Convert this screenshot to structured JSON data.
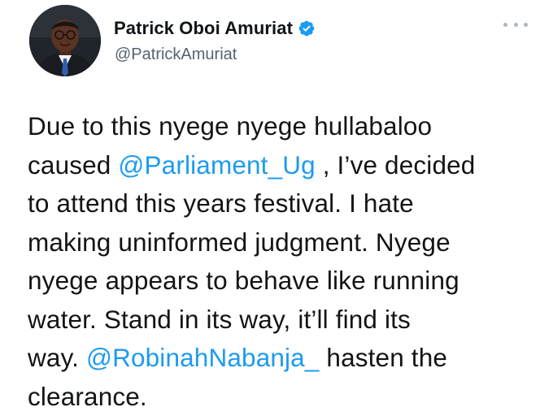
{
  "author": {
    "display_name": "Patrick Oboi Amuriat",
    "handle": "@PatrickAmuriat",
    "verified": true,
    "avatar_icon": "profile-photo"
  },
  "menu": {
    "icon": "more-options-icon"
  },
  "tweet": {
    "lines": [
      {
        "segments": [
          {
            "text": "Due to this nyege nyege hullabaloo"
          }
        ]
      },
      {
        "segments": [
          {
            "text": "caused "
          },
          {
            "text": "@Parliament_Ug",
            "mention": true
          },
          {
            "text": " , I’ve decided"
          }
        ]
      },
      {
        "segments": [
          {
            "text": "to attend this years festival. I hate"
          }
        ]
      },
      {
        "segments": [
          {
            "text": "making uninformed judgment. Nyege"
          }
        ]
      },
      {
        "segments": [
          {
            "text": "nyege appears to behave like running"
          }
        ]
      },
      {
        "segments": [
          {
            "text": "water. Stand in its way, it’ll find its"
          }
        ]
      },
      {
        "segments": [
          {
            "text": "way. "
          },
          {
            "text": "@RobinahNabanja_",
            "mention": true
          },
          {
            "text": " hasten the"
          }
        ]
      },
      {
        "segments": [
          {
            "text": "clearance."
          }
        ]
      }
    ]
  },
  "colors": {
    "mention": "#1d9bf0",
    "verified_badge": "#1d9bf0",
    "handle": "#536471"
  }
}
